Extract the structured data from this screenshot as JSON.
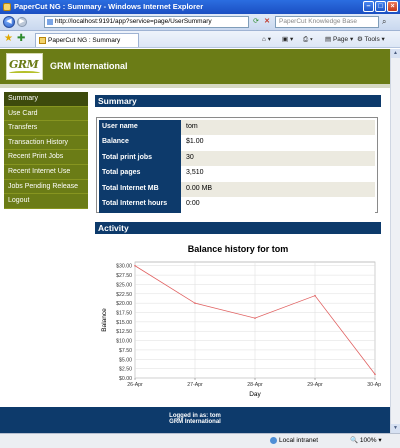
{
  "window": {
    "title": "PaperCut NG : Summary - Windows Internet Explorer",
    "minimize_icon": "minimize-icon",
    "maximize_icon": "maximize-icon",
    "close_icon": "close-icon"
  },
  "browser": {
    "url": "http://localhost:9191/app?service=page/UserSummary",
    "search_placeholder": "PaperCut Knowledge Base",
    "tab_title": "PaperCut NG : Summary",
    "commands": {
      "page": "Page",
      "tools": "Tools"
    }
  },
  "header": {
    "logo_text": "GRM",
    "org_name": "GRM International"
  },
  "sidebar": {
    "items": [
      {
        "label": "Summary",
        "active": true
      },
      {
        "label": "Use Card"
      },
      {
        "label": "Transfers"
      },
      {
        "label": "Transaction History"
      },
      {
        "label": "Recent Print Jobs"
      },
      {
        "label": "Recent Internet Use"
      },
      {
        "label": "Jobs Pending Release"
      },
      {
        "label": "Logout"
      }
    ]
  },
  "summary": {
    "title": "Summary",
    "rows": [
      {
        "label": "User name",
        "value": "tom"
      },
      {
        "label": "Balance",
        "value": "$1.00"
      },
      {
        "label": "Total print jobs",
        "value": "30"
      },
      {
        "label": "Total pages",
        "value": "3,510"
      },
      {
        "label": "Total Internet MB",
        "value": "0.00 MB"
      },
      {
        "label": "Total Internet hours",
        "value": "0:00"
      }
    ]
  },
  "activity": {
    "title": "Activity"
  },
  "chart_data": {
    "type": "line",
    "title": "Balance history for tom",
    "xlabel": "Day",
    "ylabel": "Balance",
    "categories": [
      "26-Apr",
      "27-Apr",
      "28-Apr",
      "29-Apr",
      "30-Apr"
    ],
    "values": [
      30.0,
      20.0,
      16.0,
      22.0,
      1.0
    ],
    "yticks": [
      "$0.00",
      "$2.50",
      "$5.00",
      "$7.50",
      "$10.00",
      "$12.50",
      "$15.00",
      "$17.50",
      "$20.00",
      "$22.50",
      "$25.00",
      "$27.50",
      "$30.00"
    ],
    "ylim": [
      0,
      31
    ],
    "grid": true,
    "line_color": "#e06060"
  },
  "footer": {
    "logged_in_label": "Logged in as:",
    "user": "tom",
    "org": "GRM International"
  },
  "statusbar": {
    "zone": "Local intranet",
    "zoom": "100%"
  }
}
